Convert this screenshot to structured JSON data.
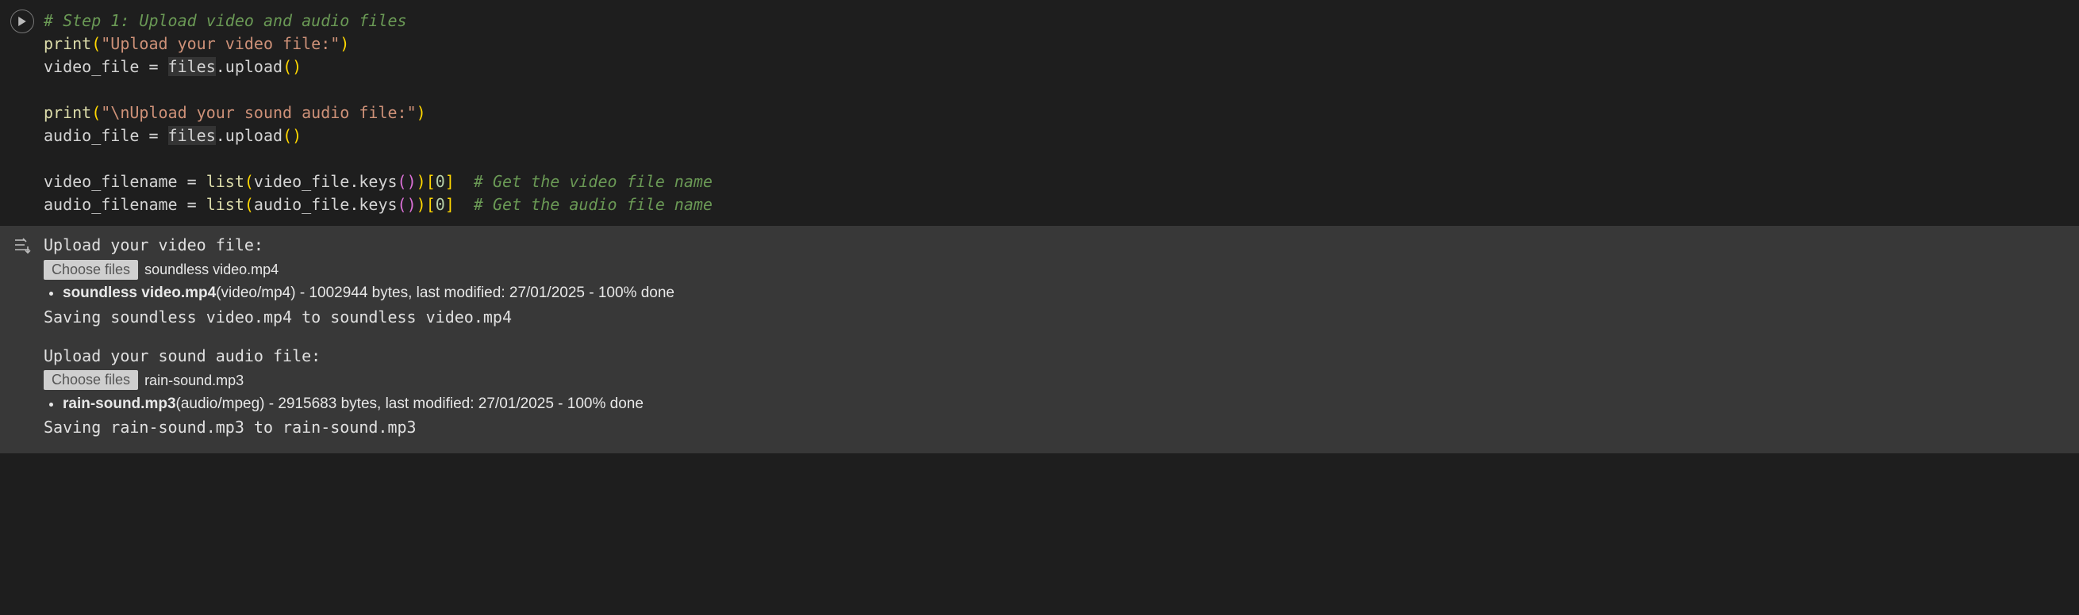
{
  "code": {
    "comment1": "# Step 1: Upload video and audio files",
    "line2_fn": "print",
    "line2_str": "\"Upload your video file:\"",
    "line3_var": "video_file = ",
    "line3_files": "files",
    "line3_upload": ".upload",
    "line5_fn": "print",
    "line5_str": "\"\\nUpload your sound audio file:\"",
    "line6_var": "audio_file = ",
    "line6_files": "files",
    "line6_upload": ".upload",
    "line8_lhs": "video_filename = ",
    "line8_list": "list",
    "line8_arg": "video_file.keys",
    "line8_idx": "0",
    "line8_comment": "# Get the video file name",
    "line9_lhs": "audio_filename = ",
    "line9_list": "list",
    "line9_arg": "audio_file.keys",
    "line9_idx": "0",
    "line9_comment": "# Get the audio file name"
  },
  "output": {
    "prompt1": "Upload your video file:",
    "choose_label": "Choose files",
    "chosen1": "soundless video.mp4",
    "item1_name": "soundless video.mp4",
    "item1_rest": "(video/mp4) - 1002944 bytes, last modified: 27/01/2025 - 100% done",
    "saving1": "Saving soundless video.mp4 to soundless video.mp4",
    "prompt2": "Upload your sound audio file:",
    "chosen2": "rain-sound.mp3",
    "item2_name": "rain-sound.mp3",
    "item2_rest": "(audio/mpeg) - 2915683 bytes, last modified: 27/01/2025 - 100% done",
    "saving2": "Saving rain-sound.mp3 to rain-sound.mp3"
  }
}
